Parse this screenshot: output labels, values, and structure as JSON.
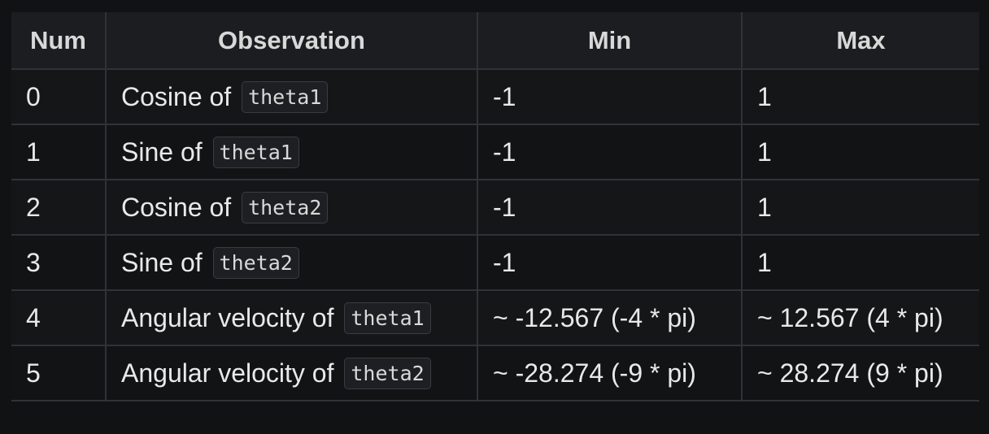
{
  "table": {
    "headers": {
      "num": "Num",
      "observation": "Observation",
      "min": "Min",
      "max": "Max"
    },
    "rows": [
      {
        "num": "0",
        "obs_text": "Cosine of",
        "obs_code": "theta1",
        "min": "-1",
        "max": "1"
      },
      {
        "num": "1",
        "obs_text": "Sine of",
        "obs_code": "theta1",
        "min": "-1",
        "max": "1"
      },
      {
        "num": "2",
        "obs_text": "Cosine of",
        "obs_code": "theta2",
        "min": "-1",
        "max": "1"
      },
      {
        "num": "3",
        "obs_text": "Sine of",
        "obs_code": "theta2",
        "min": "-1",
        "max": "1"
      },
      {
        "num": "4",
        "obs_text": "Angular velocity of",
        "obs_code": "theta1",
        "min": "~ -12.567 (-4 * pi)",
        "max": "~ 12.567 (4 * pi)"
      },
      {
        "num": "5",
        "obs_text": "Angular velocity of",
        "obs_code": "theta2",
        "min": "~ -28.274 (-9 * pi)",
        "max": "~ 28.274 (9 * pi)"
      }
    ]
  },
  "colors": {
    "background": "#111214",
    "header_background": "#1c1d20",
    "border": "#303236",
    "text": "#e9e9e9",
    "code_background": "#1e1f22"
  }
}
